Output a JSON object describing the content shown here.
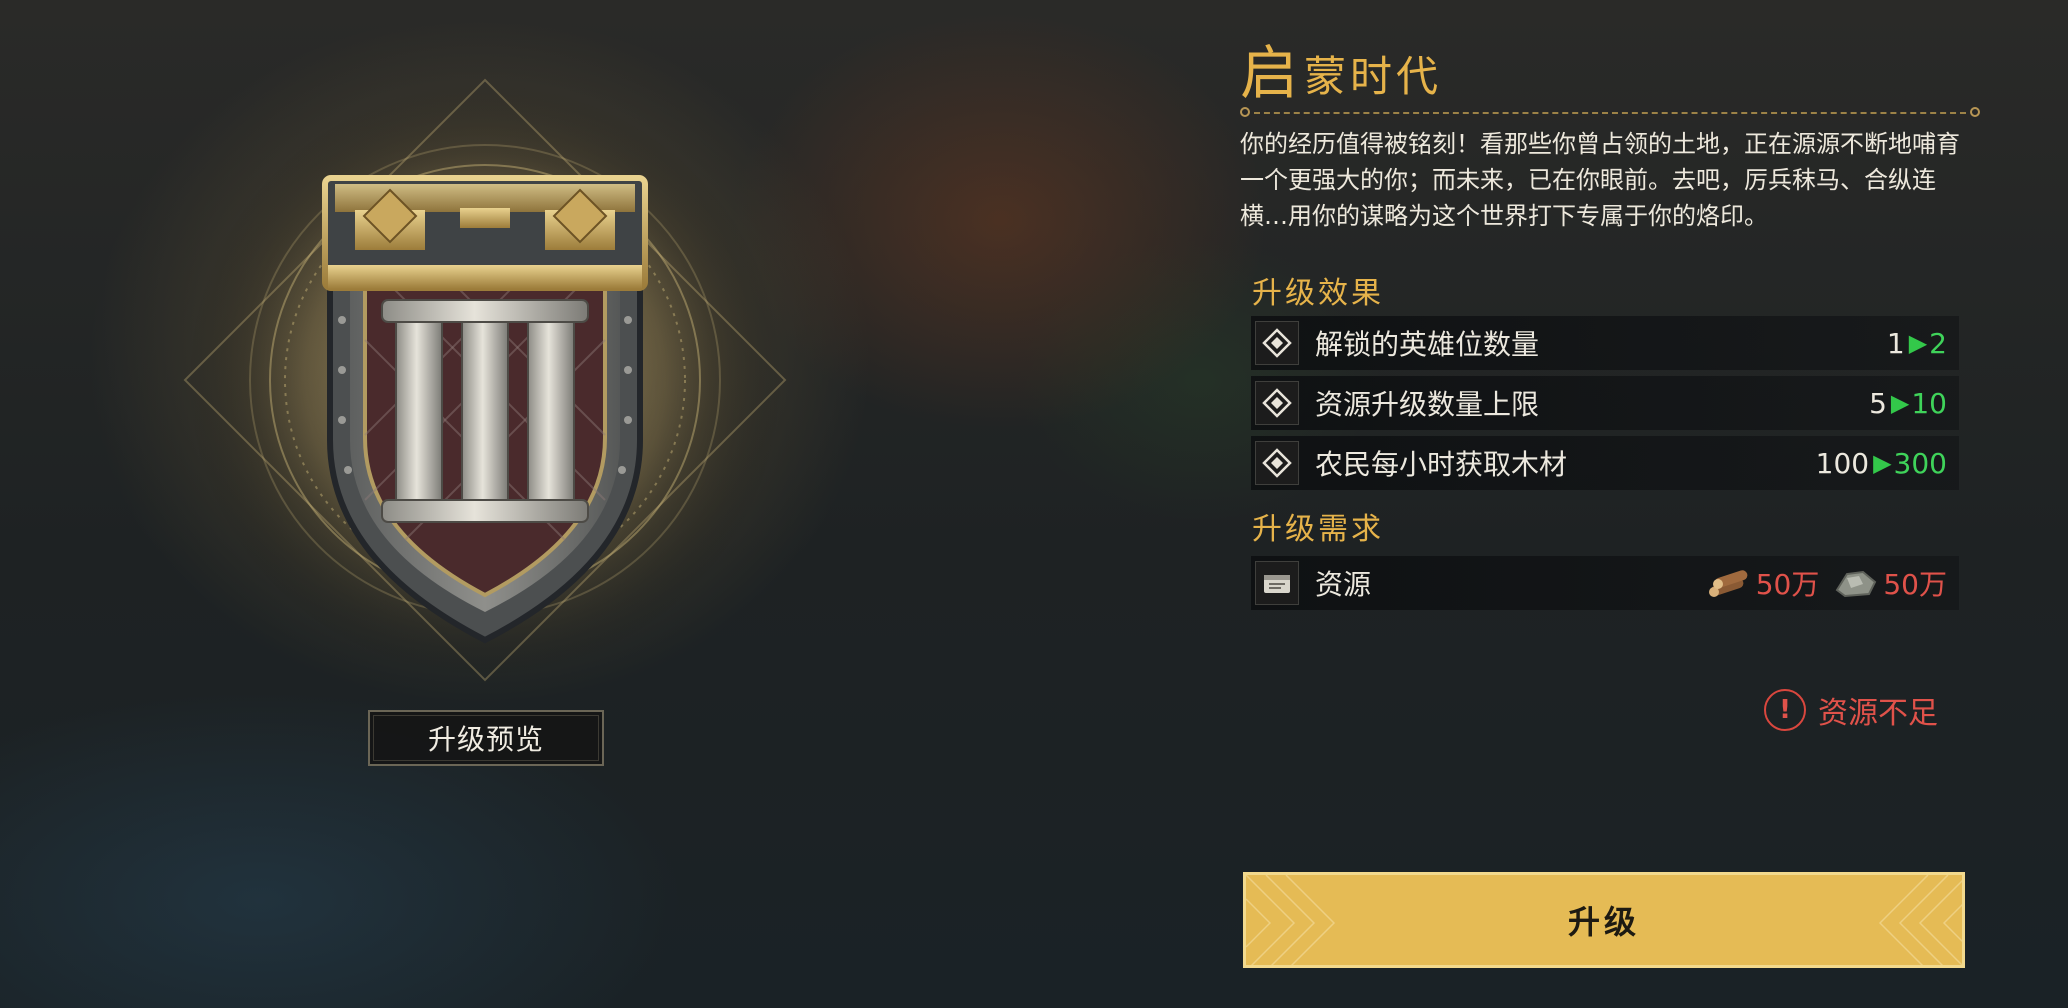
{
  "emblem": {
    "icon": "shield-roman-three-emblem"
  },
  "preview_button": {
    "label": "升级预览"
  },
  "panel": {
    "title_first": "启",
    "title_rest": "蒙时代",
    "description": "你的经历值得被铭刻！看那些你曾占领的土地，正在源源不断地哺育一个更强大的你；而未来，已在你眼前。去吧，厉兵秣马、合纵连横…用你的谋略为这个世界打下专属于你的烙印。",
    "effects_title": "升级效果",
    "effects": [
      {
        "label": "解锁的英雄位数量",
        "from": "1",
        "to": "2",
        "icon": "effect-diamond-icon"
      },
      {
        "label": "资源升级数量上限",
        "from": "5",
        "to": "10",
        "icon": "effect-diamond-icon"
      },
      {
        "label": "农民每小时获取木材",
        "from": "100",
        "to": "300",
        "icon": "effect-diamond-icon"
      }
    ],
    "requirements_title": "升级需求",
    "requirement": {
      "label": "资源",
      "icon": "resource-scroll-icon",
      "items": [
        {
          "icon": "wood-logs-icon",
          "amount": "50万"
        },
        {
          "icon": "stone-ore-icon",
          "amount": "50万"
        }
      ]
    },
    "warning": {
      "icon": "exclamation-icon",
      "text": "资源不足"
    },
    "upgrade_button": {
      "label": "升级"
    }
  },
  "colors": {
    "accent_gold": "#e6b34a",
    "increase_green": "#3fd35a",
    "insufficient_red": "#e0524a",
    "button_gold": "#e5bb55"
  }
}
